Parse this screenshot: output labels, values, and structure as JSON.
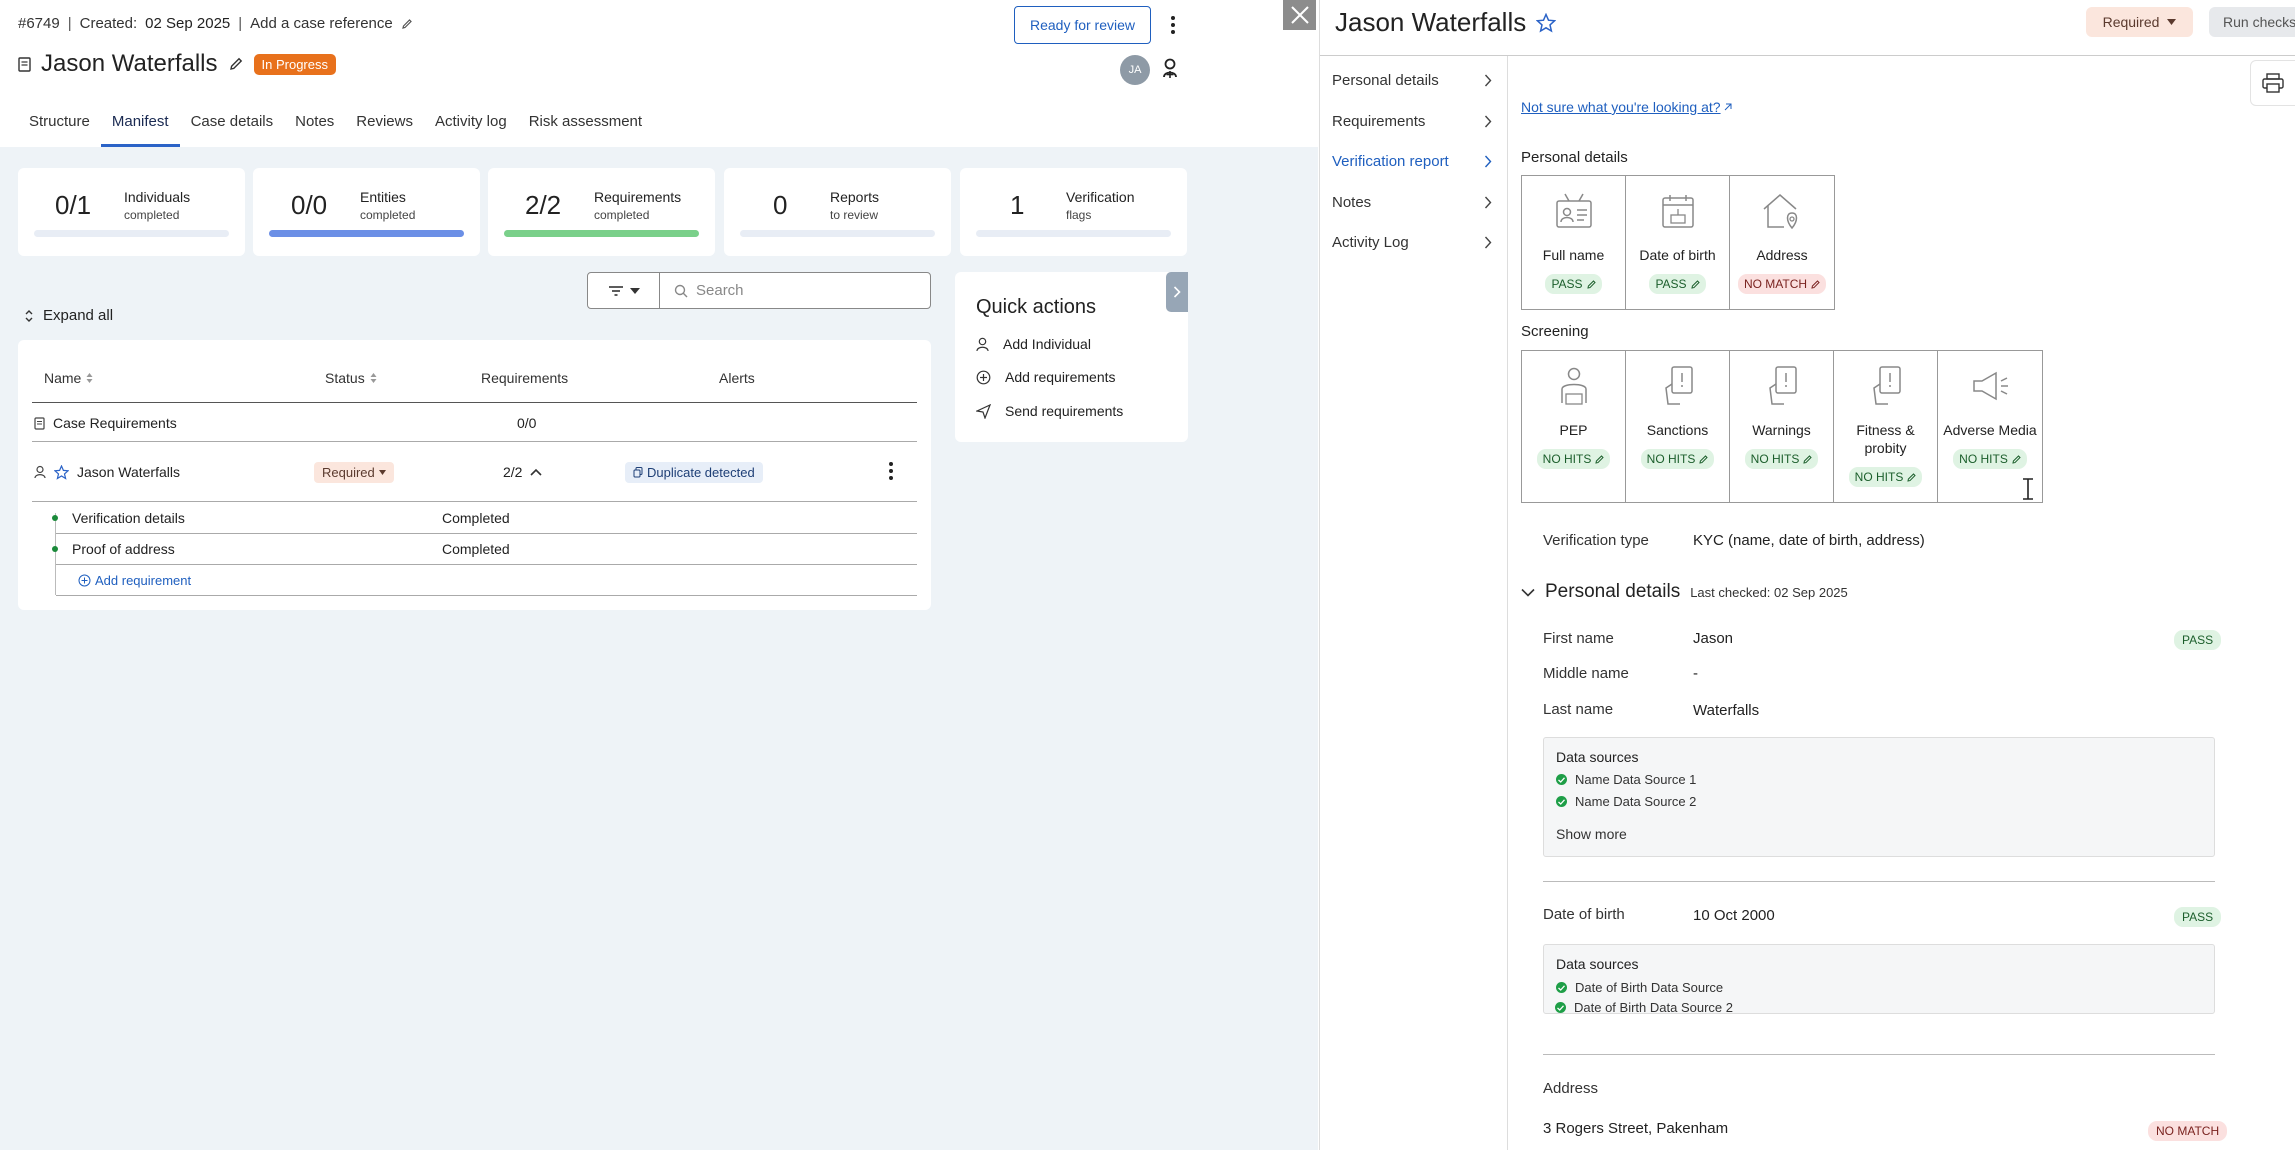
{
  "case": {
    "id": "#6749",
    "created_label": "Created:",
    "created_date": "02 Sep 2025",
    "add_reference": "Add a case reference",
    "title": "Jason Waterfalls",
    "status": "In Progress",
    "ready_button": "Ready for review",
    "avatar_initials": "JA"
  },
  "tabs": [
    "Structure",
    "Manifest",
    "Case details",
    "Notes",
    "Reviews",
    "Activity log",
    "Risk assessment"
  ],
  "stats": [
    {
      "value": "0/1",
      "label": "Individuals",
      "sub": "completed",
      "progress": 0,
      "color": "#e6ecf5"
    },
    {
      "value": "0/0",
      "label": "Entities",
      "sub": "completed",
      "progress": 1,
      "color": "#6b8fe6"
    },
    {
      "value": "2/2",
      "label": "Requirements",
      "sub": "completed",
      "progress": 1,
      "color": "#7ad08a"
    },
    {
      "value": "0",
      "label": "Reports",
      "sub": "to review",
      "progress": 0,
      "color": "#e6ecf5"
    },
    {
      "value": "1",
      "label": "Verification",
      "sub": "flags",
      "progress": 0,
      "color": "#e6ecf5"
    }
  ],
  "search": {
    "placeholder": "Search"
  },
  "expand_all": "Expand all",
  "table": {
    "headers": {
      "name": "Name",
      "status": "Status",
      "requirements": "Requirements",
      "alerts": "Alerts"
    },
    "case_requirements": {
      "label": "Case Requirements",
      "count": "0/0"
    },
    "individual": {
      "name": "Jason Waterfalls",
      "status": "Required",
      "count": "2/2",
      "alert": "Duplicate detected"
    },
    "sub_rows": [
      {
        "name": "Verification details",
        "status": "Completed"
      },
      {
        "name": "Proof of address",
        "status": "Completed"
      }
    ],
    "add_requirement": "Add requirement"
  },
  "quick_actions": {
    "title": "Quick actions",
    "items": [
      "Add Individual",
      "Add requirements",
      "Send requirements"
    ]
  },
  "panel": {
    "title": "Jason Waterfalls",
    "required": "Required",
    "run_checks": "Run checks",
    "nav": [
      "Personal details",
      "Requirements",
      "Verification report",
      "Notes",
      "Activity Log"
    ],
    "help_link": "Not sure what you're looking at?",
    "personal_section": "Personal details",
    "personal_checks": [
      {
        "name": "Full name",
        "result": "PASS",
        "icon": "id-card-icon"
      },
      {
        "name": "Date of birth",
        "result": "PASS",
        "icon": "calendar-icon"
      },
      {
        "name": "Address",
        "result": "NO MATCH",
        "icon": "house-location-icon"
      }
    ],
    "screening_section": "Screening",
    "screening_checks": [
      {
        "name": "PEP",
        "result": "NO HITS",
        "icon": "politician-icon"
      },
      {
        "name": "Sanctions",
        "result": "NO HITS",
        "icon": "sanctions-card-icon"
      },
      {
        "name": "Warnings",
        "result": "NO HITS",
        "icon": "warning-card-icon"
      },
      {
        "name": "Fitness & probity",
        "result": "NO HITS",
        "icon": "fitness-card-icon"
      },
      {
        "name": "Adverse Media",
        "result": "NO HITS",
        "icon": "megaphone-icon"
      }
    ],
    "verification_type_label": "Verification type",
    "verification_type_value": "KYC (name, date of birth, address)",
    "pd_heading": "Personal details",
    "last_checked": "Last checked:  02 Sep 2025",
    "first_name_label": "First name",
    "first_name": "Jason",
    "first_name_status": "PASS",
    "middle_name_label": "Middle name",
    "middle_name": "-",
    "last_name_label": "Last name",
    "last_name": "Waterfalls",
    "ds_title": "Data sources",
    "name_sources": [
      "Name Data Source 1",
      "Name Data Source 2"
    ],
    "show_more": "Show more",
    "dob_label": "Date of birth",
    "dob": "10 Oct 2000",
    "dob_status": "PASS",
    "dob_sources": [
      "Date of Birth Data Source",
      "Date of Birth Data Source 2"
    ],
    "address_label": "Address",
    "address_value": "3 Rogers Street, Pakenham",
    "address_status": "NO MATCH"
  }
}
